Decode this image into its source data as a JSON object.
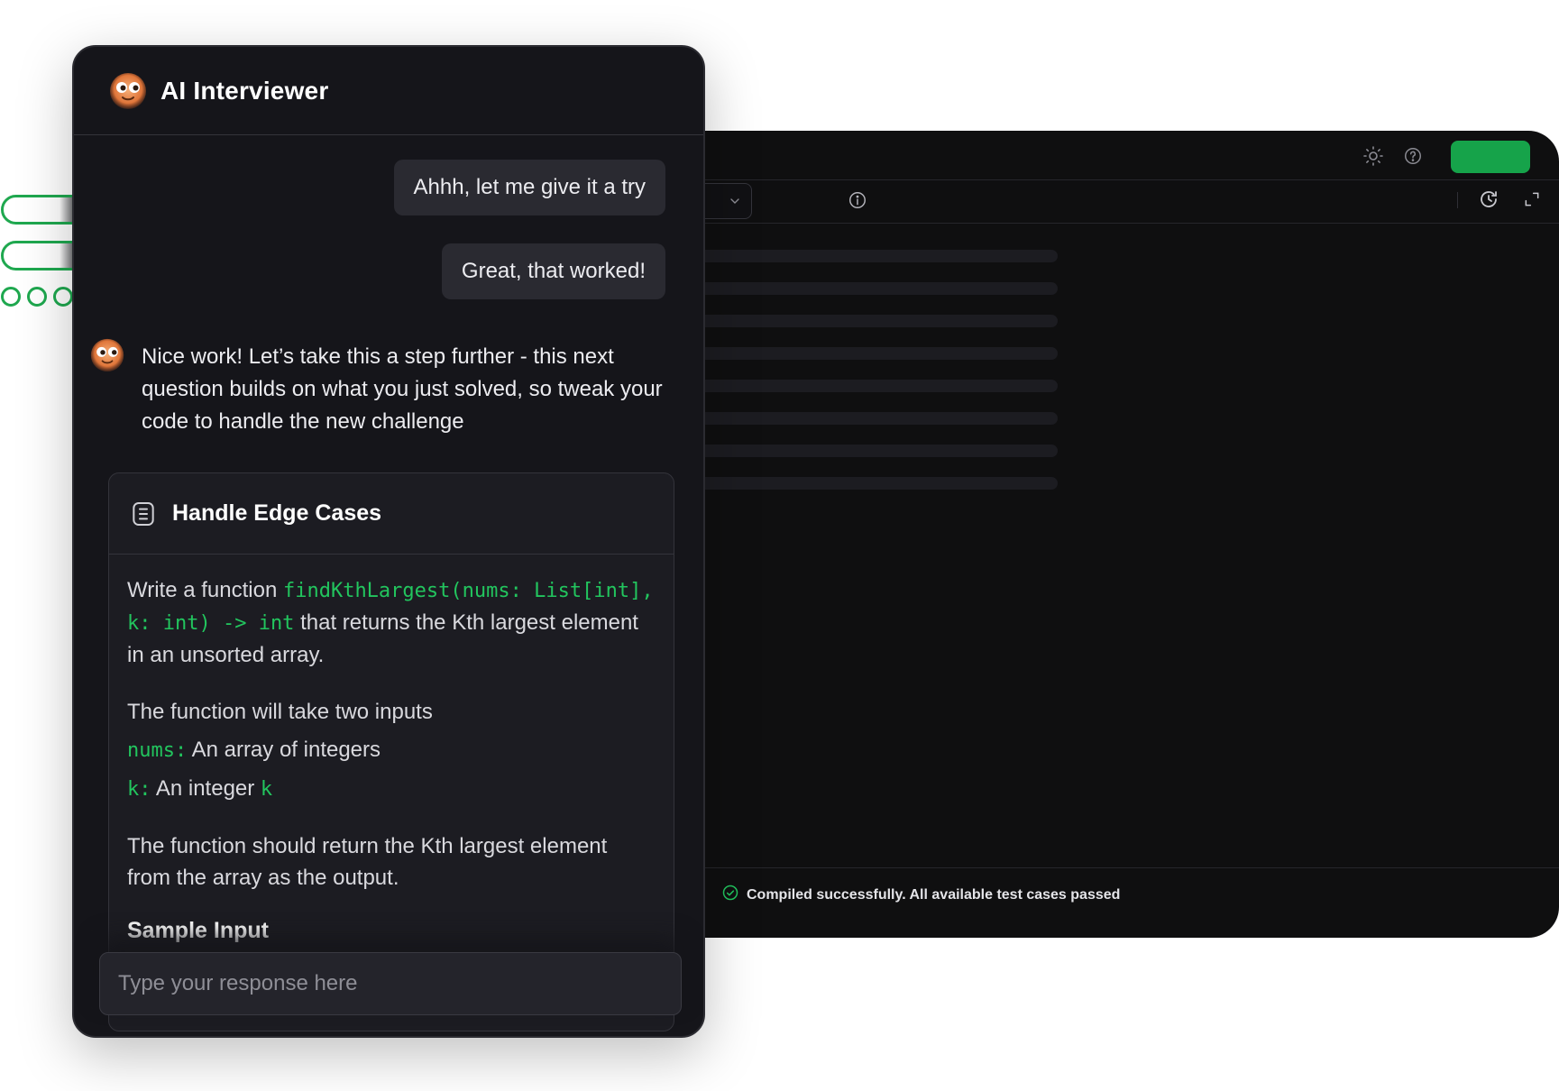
{
  "chat": {
    "title": "AI Interviewer",
    "messages": {
      "user_1": "Ahhh, let me give it a try",
      "user_2": "Great, that worked!",
      "ai_1": "Nice work! Let’s take this a step further - this next question builds on what you just solved, so tweak your code to handle the new challenge"
    },
    "task": {
      "title": "Handle Edge Cases",
      "intro_prefix": "Write a function ",
      "signature": "findKthLargest(nums: List[int], k: int) -> int",
      "intro_suffix": " that returns the Kth largest element in an unsorted array.",
      "inputs_heading": "The function will take two inputs",
      "input_1_name": "nums:",
      "input_1_desc": " An array of integers",
      "input_2_name": "k:",
      "input_2_desc": " An integer ",
      "input_2_var": "k",
      "output_text": "The function should return the Kth largest element from the array as the output.",
      "sample_heading": "Sample Input"
    },
    "input": {
      "placeholder": "Type your response here",
      "value": ""
    }
  },
  "editor": {
    "status_text": "Compiled successfully. All available test cases passed",
    "icons": [
      "sun-icon",
      "help-icon",
      "info-icon",
      "history-icon",
      "expand-icon",
      "chevron-down-icon",
      "check-circle-icon"
    ]
  },
  "colors": {
    "accent_green": "#16a34a",
    "code_green": "#22c55e",
    "panel_bg": "#15151a",
    "editor_bg": "#0f0f10"
  }
}
